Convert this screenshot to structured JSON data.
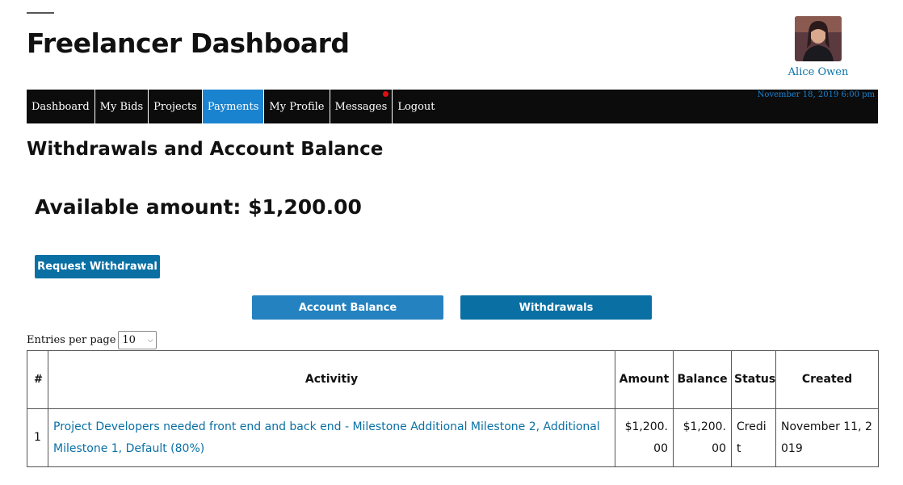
{
  "header": {
    "site_title": "Freelancer Dashboard",
    "user_name": "Alice Owen",
    "avatar_icon": "user-avatar-photo"
  },
  "nav": {
    "items": [
      {
        "label": "Dashboard"
      },
      {
        "label": "My Bids"
      },
      {
        "label": "Projects"
      },
      {
        "label": "Payments",
        "active": true
      },
      {
        "label": "My Profile"
      },
      {
        "label": "Messages",
        "has_notification": true
      },
      {
        "label": "Logout"
      }
    ],
    "datetime": "November 18, 2019 6:00 pm"
  },
  "page": {
    "heading": "Withdrawals and Account Balance",
    "available_amount": "Available amount: $1,200.00",
    "request_button": "Request Withdrawal",
    "tabs": [
      "Account Balance",
      "Withdrawals"
    ]
  },
  "table": {
    "entries_label": "Entries per page",
    "entries_value": "10",
    "columns": [
      "#",
      "Activitiy",
      "Amount",
      "Balance",
      "Status",
      "Created"
    ],
    "rows": [
      {
        "num": "1",
        "activity": "Project Developers needed front end and back end - Milestone Additional Milestone 2, Additional Milestone 1, Default (80%)",
        "amount": "$1,200.00",
        "balance": "$1,200.00",
        "status": "Credit",
        "created": "November 11, 2019"
      }
    ]
  },
  "colors": {
    "nav_bg": "#0c0c0d",
    "nav_active": "#1a83d0",
    "primary_button": "#0a70a4",
    "tab_balance": "#2582c0",
    "link": "#0a70a4",
    "notification": "#e01010"
  }
}
